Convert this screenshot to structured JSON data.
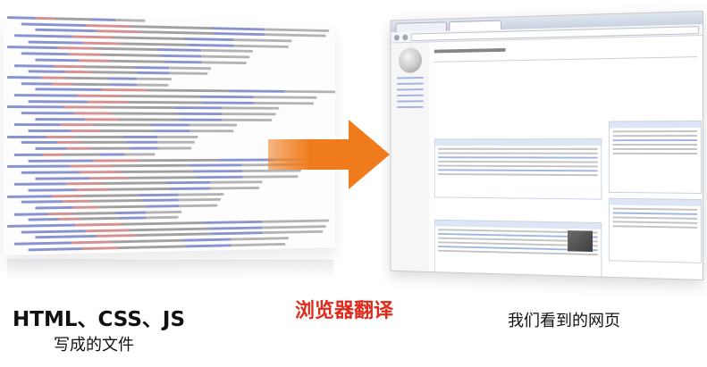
{
  "captions": {
    "source_line1": "HTML、CSS、JS",
    "source_line2": "写成的文件",
    "process": "浏览器翻译",
    "result": "我们看到的网页"
  },
  "colors": {
    "arrow": "#f07b1c",
    "process_text": "#e02a1c"
  },
  "icons": {
    "arrow": "right-arrow-icon",
    "logo": "wikipedia-globe-icon"
  }
}
